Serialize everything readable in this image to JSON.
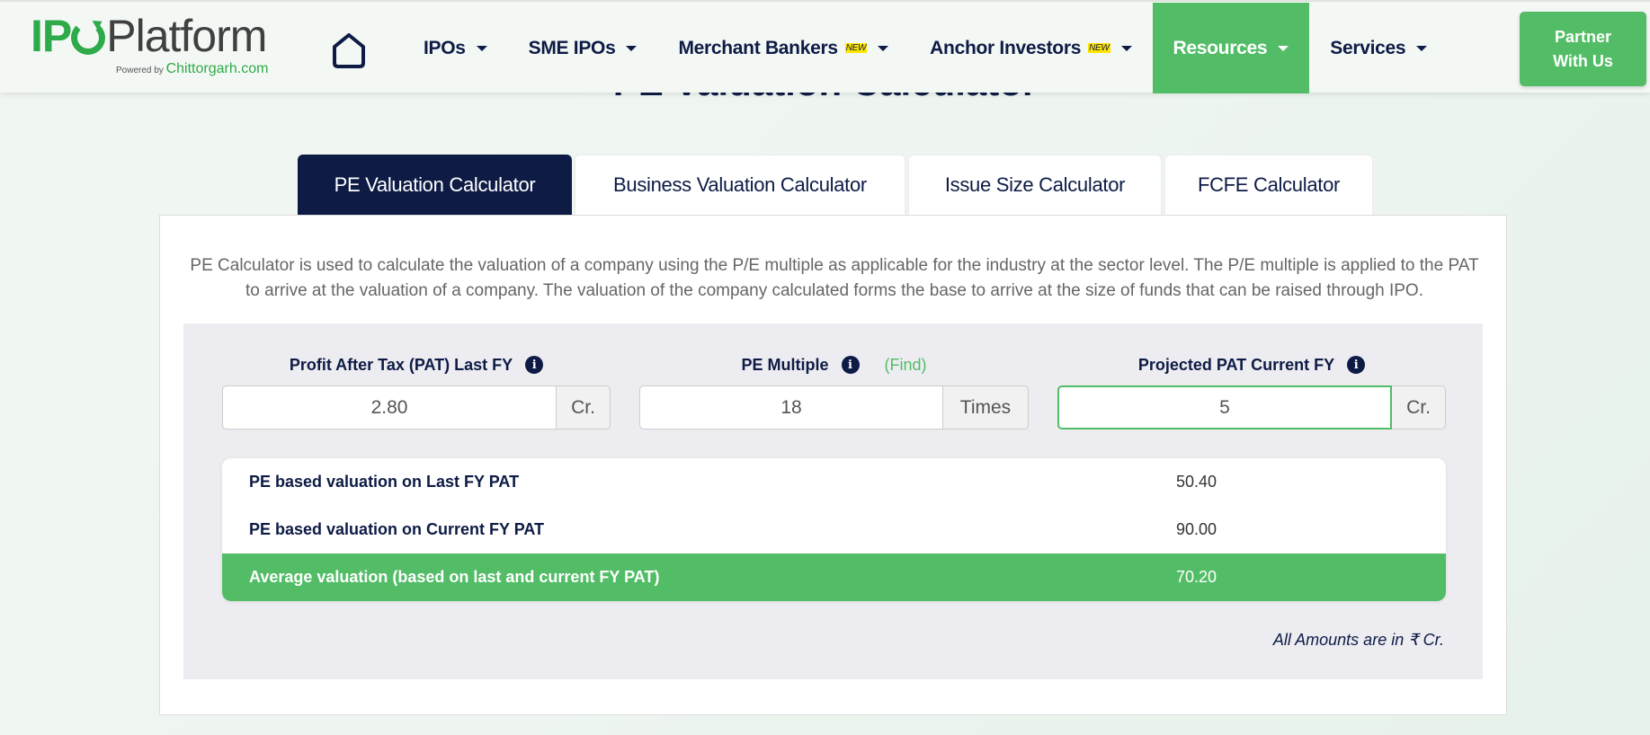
{
  "header": {
    "logo": {
      "prefix": "IP",
      "suffix": "Platform",
      "powered_by": "Powered by",
      "powered_site": "Chittorgarh.com"
    },
    "nav": [
      {
        "label": "IPOs",
        "badge": null,
        "active": false
      },
      {
        "label": "SME IPOs",
        "badge": null,
        "active": false
      },
      {
        "label": "Merchant Bankers",
        "badge": "NEW",
        "active": false
      },
      {
        "label": "Anchor Investors",
        "badge": "NEW",
        "active": false
      },
      {
        "label": "Resources",
        "badge": null,
        "active": true
      },
      {
        "label": "Services",
        "badge": null,
        "active": false
      }
    ],
    "partner_button": {
      "line1": "Partner",
      "line2": "With Us"
    }
  },
  "page_title": "PE Valuation Calculator",
  "tabs": [
    {
      "label": "PE Valuation Calculator",
      "active": true
    },
    {
      "label": "Business Valuation Calculator",
      "active": false
    },
    {
      "label": "Issue Size Calculator",
      "active": false
    },
    {
      "label": "FCFE Calculator",
      "active": false
    }
  ],
  "description": "PE Calculator is used to calculate the valuation of a company using the P/E multiple as applicable for the industry at the sector level. The P/E multiple is applied to the PAT to arrive at the valuation of a company. The valuation of the company calculated forms the base to arrive at the size of funds that can be raised through IPO.",
  "fields": {
    "pat_last_fy": {
      "label": "Profit After Tax (PAT) Last FY",
      "value": "2.80",
      "unit": "Cr."
    },
    "pe_multiple": {
      "label": "PE Multiple",
      "find_link": "(Find)",
      "value": "18",
      "unit": "Times"
    },
    "pat_current_fy": {
      "label": "Projected PAT Current FY",
      "value": "5",
      "unit": "Cr."
    }
  },
  "results": [
    {
      "label": "PE based valuation on Last FY PAT",
      "value": "50.40"
    },
    {
      "label": "PE based valuation on Current FY PAT",
      "value": "90.00"
    },
    {
      "label": "Average valuation (based on last and current FY PAT)",
      "value": "70.20"
    }
  ],
  "amount_note": "All Amounts are in ₹ Cr.",
  "colors": {
    "brand_green": "#52bd66",
    "navy": "#0d1b45",
    "new_badge": "#ffe400"
  }
}
